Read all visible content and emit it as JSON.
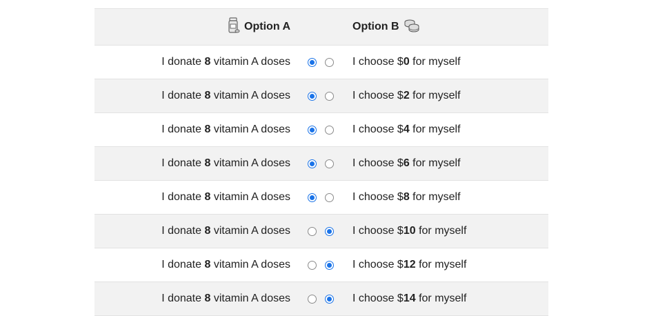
{
  "header": {
    "option_a_label": "Option A",
    "option_a_icon": "medicine-bottle-icon",
    "option_b_label": "Option B",
    "option_b_icon": "coins-icon"
  },
  "colors": {
    "radio_checked": "#1a73e8",
    "row_shade": "#f2f2f2"
  },
  "rows": [
    {
      "left_prefix": "I donate ",
      "left_bold": "8",
      "left_suffix": " vitamin A doses",
      "right_prefix": "I choose $",
      "right_bold": "0",
      "right_suffix": " for myself",
      "selected": "A"
    },
    {
      "left_prefix": "I donate ",
      "left_bold": "8",
      "left_suffix": " vitamin A doses",
      "right_prefix": "I choose $",
      "right_bold": "2",
      "right_suffix": " for myself",
      "selected": "A"
    },
    {
      "left_prefix": "I donate ",
      "left_bold": "8",
      "left_suffix": " vitamin A doses",
      "right_prefix": "I choose $",
      "right_bold": "4",
      "right_suffix": " for myself",
      "selected": "A"
    },
    {
      "left_prefix": "I donate ",
      "left_bold": "8",
      "left_suffix": " vitamin A doses",
      "right_prefix": "I choose $",
      "right_bold": "6",
      "right_suffix": " for myself",
      "selected": "A"
    },
    {
      "left_prefix": "I donate ",
      "left_bold": "8",
      "left_suffix": " vitamin A doses",
      "right_prefix": "I choose $",
      "right_bold": "8",
      "right_suffix": " for myself",
      "selected": "A"
    },
    {
      "left_prefix": "I donate ",
      "left_bold": "8",
      "left_suffix": " vitamin A doses",
      "right_prefix": "I choose $",
      "right_bold": "10",
      "right_suffix": " for myself",
      "selected": "B"
    },
    {
      "left_prefix": "I donate ",
      "left_bold": "8",
      "left_suffix": " vitamin A doses",
      "right_prefix": "I choose $",
      "right_bold": "12",
      "right_suffix": " for myself",
      "selected": "B"
    },
    {
      "left_prefix": "I donate ",
      "left_bold": "8",
      "left_suffix": " vitamin A doses",
      "right_prefix": "I choose $",
      "right_bold": "14",
      "right_suffix": " for myself",
      "selected": "B"
    }
  ]
}
